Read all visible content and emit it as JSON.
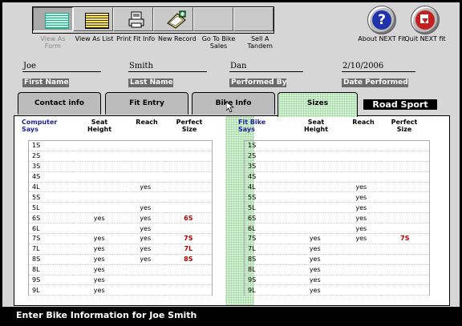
{
  "toolbar": {
    "buttons": [
      {
        "label": "View As Form",
        "disabled": true,
        "icon": "form-icon"
      },
      {
        "label": "View As List",
        "disabled": false,
        "icon": "list-icon"
      },
      {
        "label": "Print Fit Info",
        "disabled": false,
        "icon": "printer-icon"
      },
      {
        "label": "New Record",
        "disabled": false,
        "icon": "new-record-icon"
      },
      {
        "label": "Go To Bike Sales",
        "disabled": false,
        "icon": ""
      },
      {
        "label": "Sell A Tandem",
        "disabled": false,
        "icon": ""
      }
    ],
    "about_label": "About NEXT Fit",
    "quit_label": "Quit NEXT fit"
  },
  "form": {
    "first_name": {
      "value": "Joe",
      "label": "First Name"
    },
    "last_name": {
      "value": "Smith",
      "label": "Last Name"
    },
    "performed_by": {
      "value": "Dan",
      "label": "Performed By"
    },
    "date_performed": {
      "value": "2/10/2006",
      "label": "Date Performed"
    }
  },
  "tabs": [
    "Contact info",
    "Fit Entry",
    "Bike Info",
    "Sizes"
  ],
  "selected_tab": "Sizes",
  "bike_type": "Road Sport",
  "tables": {
    "computer": {
      "header_title": "Computer Says",
      "col_seat": "Seat Height",
      "col_reach": "Reach",
      "col_perfect": "Perfect Size",
      "rows": [
        [
          "1S",
          "",
          "",
          ""
        ],
        [
          "2S",
          "",
          "",
          ""
        ],
        [
          "3S",
          "",
          "",
          ""
        ],
        [
          "4S",
          "",
          "",
          ""
        ],
        [
          "4L",
          "",
          "yes",
          ""
        ],
        [
          "5S",
          "",
          "",
          ""
        ],
        [
          "5L",
          "",
          "yes",
          ""
        ],
        [
          "6S",
          "yes",
          "yes",
          "6S"
        ],
        [
          "6L",
          "",
          "yes",
          ""
        ],
        [
          "7S",
          "yes",
          "yes",
          "7S"
        ],
        [
          "7L",
          "yes",
          "yes",
          "7L"
        ],
        [
          "8S",
          "yes",
          "yes",
          "8S"
        ],
        [
          "8L",
          "yes",
          "",
          ""
        ],
        [
          "9S",
          "yes",
          "",
          ""
        ],
        [
          "9L",
          "yes",
          "",
          ""
        ]
      ]
    },
    "fitbike": {
      "header_title": "Fit Bike Says",
      "col_seat": "Seat Height",
      "col_reach": "Reach",
      "col_perfect": "Perfect Size",
      "rows": [
        [
          "1S",
          "",
          "",
          ""
        ],
        [
          "2S",
          "",
          "",
          ""
        ],
        [
          "3S",
          "",
          "",
          ""
        ],
        [
          "4S",
          "",
          "",
          ""
        ],
        [
          "4L",
          "",
          "yes",
          ""
        ],
        [
          "5S",
          "",
          "yes",
          ""
        ],
        [
          "5L",
          "",
          "yes",
          ""
        ],
        [
          "6S",
          "",
          "yes",
          ""
        ],
        [
          "6L",
          "",
          "yes",
          ""
        ],
        [
          "7S",
          "yes",
          "yes",
          "7S"
        ],
        [
          "7L",
          "yes",
          "",
          ""
        ],
        [
          "8S",
          "yes",
          "",
          ""
        ],
        [
          "8L",
          "yes",
          "",
          ""
        ],
        [
          "9S",
          "yes",
          "",
          ""
        ],
        [
          "9L",
          "yes",
          "",
          ""
        ]
      ]
    }
  },
  "status": "Enter Bike Information for Joe Smith",
  "colors": {
    "accent_blue": "#1f1fa0",
    "perfect_red": "#aa0000",
    "tab_green": "#d6f0d6"
  }
}
